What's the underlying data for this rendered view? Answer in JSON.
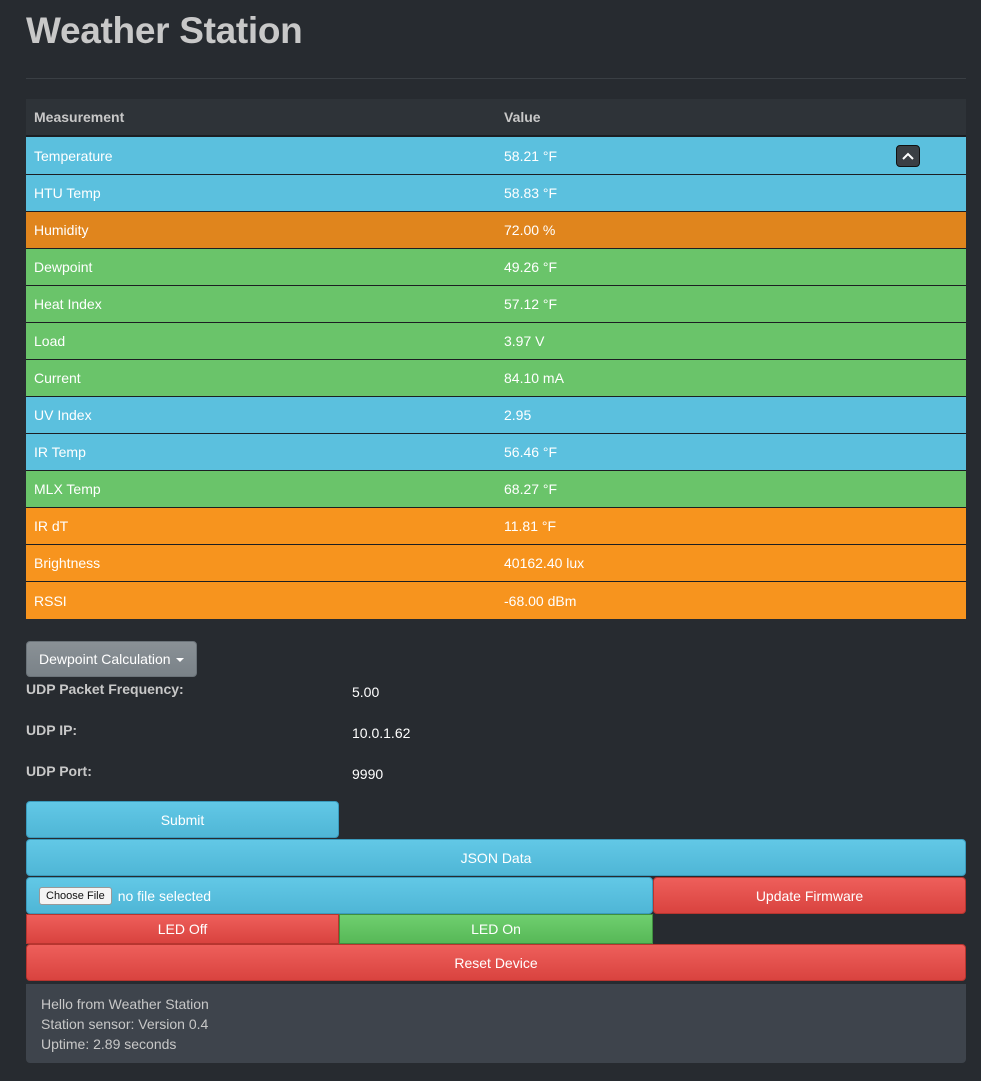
{
  "page": {
    "title": "Weather Station"
  },
  "table": {
    "headers": {
      "measurement": "Measurement",
      "value": "Value"
    },
    "rows": [
      {
        "name": "Temperature",
        "value": "58.21 °F",
        "status": "info"
      },
      {
        "name": "HTU Temp",
        "value": "58.83 °F",
        "status": "info"
      },
      {
        "name": "Humidity",
        "value": "72.00 %",
        "status": "warn-dark"
      },
      {
        "name": "Dewpoint",
        "value": "49.26 °F",
        "status": "success"
      },
      {
        "name": "Heat Index",
        "value": "57.12 °F",
        "status": "success"
      },
      {
        "name": "Load",
        "value": "3.97 V",
        "status": "success"
      },
      {
        "name": "Current",
        "value": "84.10 mA",
        "status": "success"
      },
      {
        "name": "UV Index",
        "value": "2.95",
        "status": "info"
      },
      {
        "name": "IR Temp",
        "value": "56.46 °F",
        "status": "info"
      },
      {
        "name": "MLX Temp",
        "value": "68.27 °F",
        "status": "success"
      },
      {
        "name": "IR dT",
        "value": "11.81 °F",
        "status": "warning"
      },
      {
        "name": "Brightness",
        "value": "40162.40 lux",
        "status": "warning"
      },
      {
        "name": "RSSI",
        "value": "-68.00 dBm",
        "status": "warning"
      }
    ],
    "collapse_icon": "chevron-up-icon"
  },
  "dropdown": {
    "label": "Dewpoint Calculation"
  },
  "udp": {
    "frequency_label": "UDP Packet Frequency:",
    "frequency_value": "5.00",
    "ip_label": "UDP IP:",
    "ip_value": "10.0.1.62",
    "port_label": "UDP Port:",
    "port_value": "9990"
  },
  "buttons": {
    "submit": "Submit",
    "json_data": "JSON Data",
    "choose_file": "Choose File",
    "file_status": "no file selected",
    "update_firmware": "Update Firmware",
    "led_off": "LED Off",
    "led_on": "LED On",
    "reset_device": "Reset Device"
  },
  "status": {
    "line1": "Hello from Weather Station",
    "line2": "Station sensor: Version 0.4",
    "line3": "Uptime: 2.89 seconds"
  },
  "colors": {
    "background": "#272b30",
    "info": "#5bc0de",
    "success": "#6ac46a",
    "warning": "#f7941e",
    "danger": "#d9534f"
  }
}
